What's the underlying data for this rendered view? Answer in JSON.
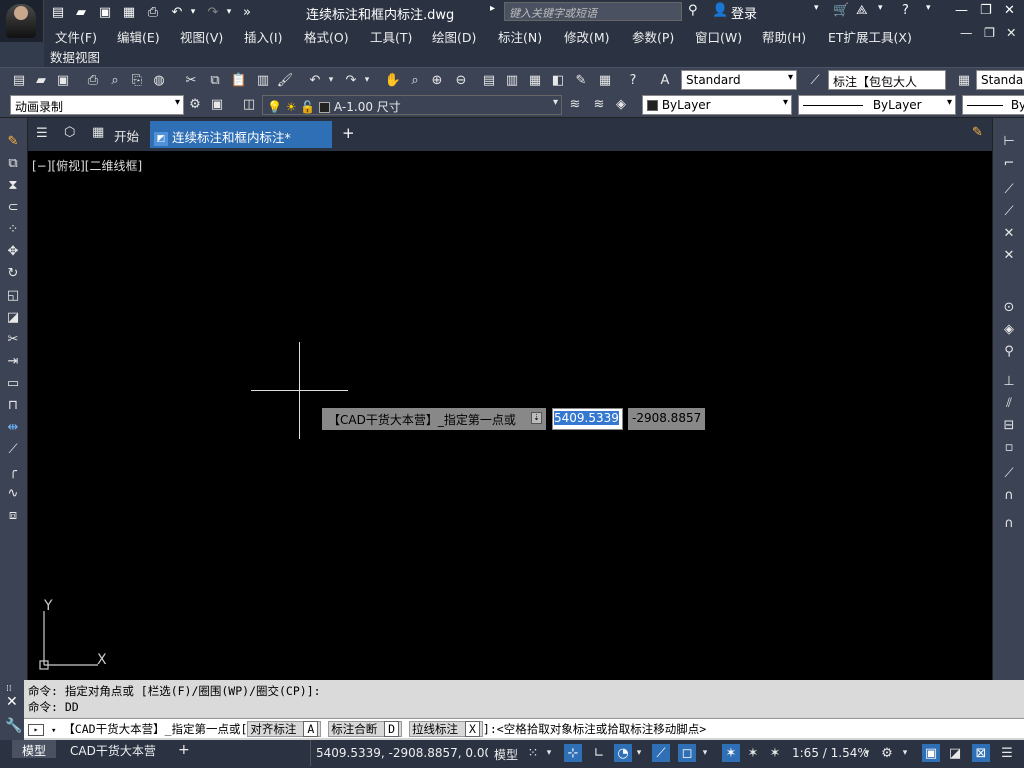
{
  "titlebar": {
    "document_title": "连续标注和框内标注.dwg",
    "search_placeholder": "键入关键字或短语",
    "login_label": "登录"
  },
  "menu": {
    "items": [
      "文件(F)",
      "编辑(E)",
      "视图(V)",
      "插入(I)",
      "格式(O)",
      "工具(T)",
      "绘图(D)",
      "标注(N)",
      "修改(M)",
      "参数(P)",
      "窗口(W)",
      "帮助(H)",
      "ET扩展工具(X)"
    ],
    "second_row": "数据视图"
  },
  "ribbon": {
    "text_style": "Standard",
    "dim_style": "标注【包包大人",
    "table_style": "Standar"
  },
  "properties": {
    "workspace": "动画录制",
    "layer": "A-1.00 尺寸",
    "color": "ByLayer",
    "linetype": "ByLayer",
    "lineweight": "By"
  },
  "tabs": {
    "start_label": "开始",
    "active_tab": "连续标注和框内标注*",
    "add_tab": "+"
  },
  "canvas": {
    "view_label": "[−][俯视][二维线框]",
    "dynamic_prompt": "【CAD干货大本营】_指定第一点或",
    "coord_x": "5409.5339",
    "coord_y": "-2908.8857",
    "ucs_y": "Y",
    "ucs_x": "X"
  },
  "command": {
    "history": [
      "命令: 指定对角点或 [栏选(F)/圈围(WP)/圈交(CP)]:",
      "命令: DD"
    ],
    "prompt_prefix": "【CAD干货大本营】_指定第一点或[",
    "opt1": "对齐标注",
    "key1": "A",
    "opt2": "标注合断",
    "key2": "D",
    "opt3": "拉线标注",
    "key3": "X",
    "prompt_suffix": "]:<空格拾取对象标注或拾取标注移动脚点>"
  },
  "status": {
    "model_tab": "模型",
    "layout_tab": "CAD干货大本营",
    "add_layout": "+",
    "coordinates": "5409.5339, -2908.8857, 0.00...",
    "space": "模型",
    "scale": "1:65 / 1.54%"
  }
}
